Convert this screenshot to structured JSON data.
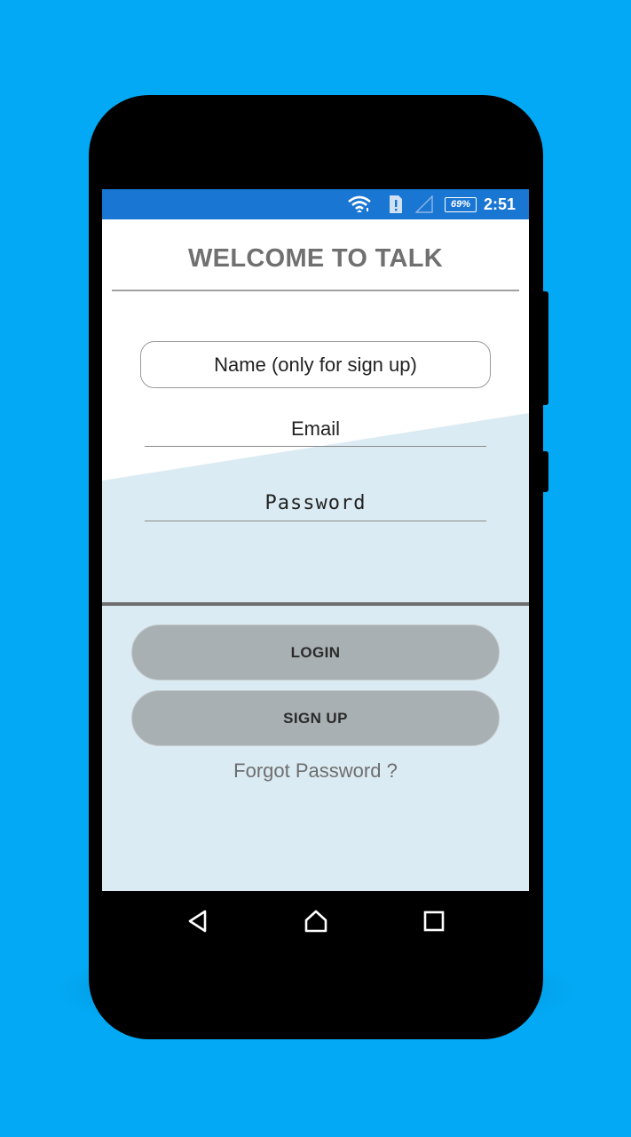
{
  "status_bar": {
    "battery_percent": "69%",
    "time": "2:51",
    "icons": [
      "wifi-icon",
      "sim-alert-icon",
      "signal-icon",
      "battery-icon"
    ],
    "color": "#1976d2"
  },
  "header": {
    "title": "WELCOME TO TALK"
  },
  "form": {
    "name_placeholder": "Name (only for sign up)",
    "email_placeholder": "Email",
    "password_placeholder": "Password"
  },
  "actions": {
    "login_label": "LOGIN",
    "signup_label": "SIGN UP",
    "forgot_label": "Forgot Password ?"
  },
  "nav_bar": {
    "icons": [
      "back-icon",
      "home-icon",
      "recents-icon"
    ]
  },
  "colors": {
    "background": "#03a9f4",
    "panel": "#dbebf3",
    "button": "#a9b0b3"
  }
}
